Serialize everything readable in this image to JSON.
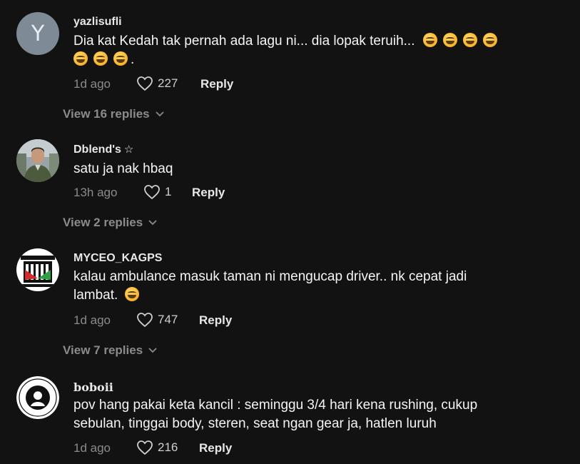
{
  "comments": [
    {
      "username": "yazlisufli",
      "avatar_letter": "Y",
      "text_line1": "Dia kat Kedah tak pernah ada lagu ni... dia lopak teruih...",
      "text_line2_suffix": ".",
      "time": "1d ago",
      "likes": "227",
      "reply_label": "Reply",
      "view_replies": "View 16 replies"
    },
    {
      "username": "Dblend's",
      "star": "☆",
      "text": "satu ja nak hbaq",
      "time": "13h ago",
      "likes": "1",
      "reply_label": "Reply",
      "view_replies": "View 2 replies"
    },
    {
      "username": "MYCEO_KAGPS",
      "text": "kalau ambulance masuk taman ni mengucap driver.. nk cepat jadi lambat.",
      "time": "1d ago",
      "likes": "747",
      "reply_label": "Reply",
      "view_replies": "View 7 replies"
    },
    {
      "username": "boboii",
      "text": "pov hang pakai keta kancil : seminggu 3/4 hari kena rushing, cukup sebulan, tinggai body, steren, seat ngan gear ja, hatlen luruh",
      "time": "1d ago",
      "likes": "216",
      "reply_label": "Reply"
    }
  ],
  "icons": {
    "like": "heart-icon",
    "expand": "chevron-down-icon"
  },
  "colors": {
    "background": "#121212",
    "muted": "#8b8b8b",
    "text": "#f5f5f5"
  }
}
